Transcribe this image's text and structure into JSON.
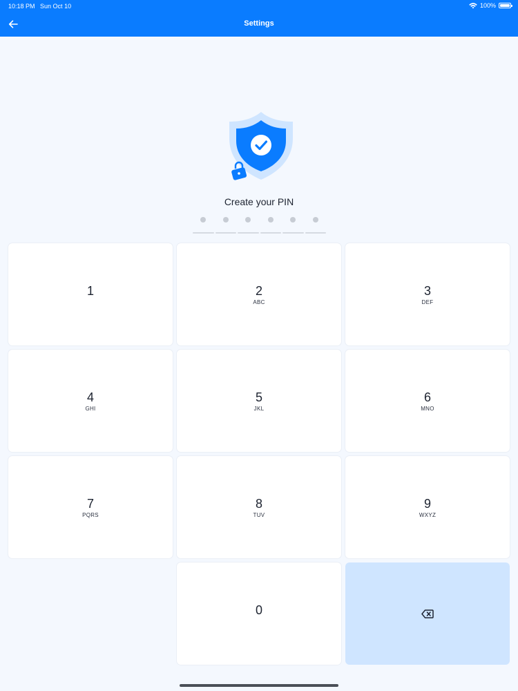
{
  "status": {
    "time": "10:18 PM",
    "date": "Sun Oct 10",
    "battery": "100%",
    "battery_level": 1.0
  },
  "nav": {
    "title": "Settings",
    "back_icon": "arrow-left-icon"
  },
  "pin": {
    "prompt": "Create your PIN",
    "length": 6,
    "entered": 0
  },
  "keypad": {
    "keys": [
      {
        "digit": "1",
        "letters": ""
      },
      {
        "digit": "2",
        "letters": "ABC"
      },
      {
        "digit": "3",
        "letters": "DEF"
      },
      {
        "digit": "4",
        "letters": "GHI"
      },
      {
        "digit": "5",
        "letters": "JKL"
      },
      {
        "digit": "6",
        "letters": "MNO"
      },
      {
        "digit": "7",
        "letters": "PQRS"
      },
      {
        "digit": "8",
        "letters": "TUV"
      },
      {
        "digit": "9",
        "letters": "WXYZ"
      },
      {
        "digit": "0",
        "letters": ""
      }
    ],
    "delete_icon": "backspace-icon"
  },
  "colors": {
    "accent": "#0a7cff",
    "background": "#f4f8fe",
    "delete_key": "#cfe5ff"
  }
}
